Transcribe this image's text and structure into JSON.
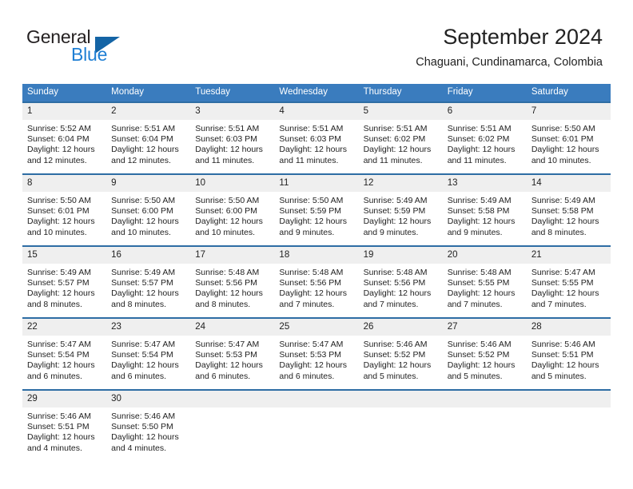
{
  "brand": {
    "name_top": "General",
    "name_bottom": "Blue",
    "triangle_icon": "triangle-logo-icon",
    "color_dark": "#231f20",
    "color_blue": "#1f7fd4",
    "color_triangle": "#1464a5"
  },
  "header": {
    "title": "September 2024",
    "subtitle": "Chaguani, Cundinamarca, Colombia"
  },
  "colors": {
    "header_row_bg": "#3a7cbe",
    "header_row_text": "#ffffff",
    "row_border": "#2e6da4",
    "daynum_bg": "#efefef",
    "text": "#222222"
  },
  "weekdays": [
    "Sunday",
    "Monday",
    "Tuesday",
    "Wednesday",
    "Thursday",
    "Friday",
    "Saturday"
  ],
  "weeks": [
    [
      {
        "day": "1",
        "sunrise": "Sunrise: 5:52 AM",
        "sunset": "Sunset: 6:04 PM",
        "daylight1": "Daylight: 12 hours",
        "daylight2": "and 12 minutes."
      },
      {
        "day": "2",
        "sunrise": "Sunrise: 5:51 AM",
        "sunset": "Sunset: 6:04 PM",
        "daylight1": "Daylight: 12 hours",
        "daylight2": "and 12 minutes."
      },
      {
        "day": "3",
        "sunrise": "Sunrise: 5:51 AM",
        "sunset": "Sunset: 6:03 PM",
        "daylight1": "Daylight: 12 hours",
        "daylight2": "and 11 minutes."
      },
      {
        "day": "4",
        "sunrise": "Sunrise: 5:51 AM",
        "sunset": "Sunset: 6:03 PM",
        "daylight1": "Daylight: 12 hours",
        "daylight2": "and 11 minutes."
      },
      {
        "day": "5",
        "sunrise": "Sunrise: 5:51 AM",
        "sunset": "Sunset: 6:02 PM",
        "daylight1": "Daylight: 12 hours",
        "daylight2": "and 11 minutes."
      },
      {
        "day": "6",
        "sunrise": "Sunrise: 5:51 AM",
        "sunset": "Sunset: 6:02 PM",
        "daylight1": "Daylight: 12 hours",
        "daylight2": "and 11 minutes."
      },
      {
        "day": "7",
        "sunrise": "Sunrise: 5:50 AM",
        "sunset": "Sunset: 6:01 PM",
        "daylight1": "Daylight: 12 hours",
        "daylight2": "and 10 minutes."
      }
    ],
    [
      {
        "day": "8",
        "sunrise": "Sunrise: 5:50 AM",
        "sunset": "Sunset: 6:01 PM",
        "daylight1": "Daylight: 12 hours",
        "daylight2": "and 10 minutes."
      },
      {
        "day": "9",
        "sunrise": "Sunrise: 5:50 AM",
        "sunset": "Sunset: 6:00 PM",
        "daylight1": "Daylight: 12 hours",
        "daylight2": "and 10 minutes."
      },
      {
        "day": "10",
        "sunrise": "Sunrise: 5:50 AM",
        "sunset": "Sunset: 6:00 PM",
        "daylight1": "Daylight: 12 hours",
        "daylight2": "and 10 minutes."
      },
      {
        "day": "11",
        "sunrise": "Sunrise: 5:50 AM",
        "sunset": "Sunset: 5:59 PM",
        "daylight1": "Daylight: 12 hours",
        "daylight2": "and 9 minutes."
      },
      {
        "day": "12",
        "sunrise": "Sunrise: 5:49 AM",
        "sunset": "Sunset: 5:59 PM",
        "daylight1": "Daylight: 12 hours",
        "daylight2": "and 9 minutes."
      },
      {
        "day": "13",
        "sunrise": "Sunrise: 5:49 AM",
        "sunset": "Sunset: 5:58 PM",
        "daylight1": "Daylight: 12 hours",
        "daylight2": "and 9 minutes."
      },
      {
        "day": "14",
        "sunrise": "Sunrise: 5:49 AM",
        "sunset": "Sunset: 5:58 PM",
        "daylight1": "Daylight: 12 hours",
        "daylight2": "and 8 minutes."
      }
    ],
    [
      {
        "day": "15",
        "sunrise": "Sunrise: 5:49 AM",
        "sunset": "Sunset: 5:57 PM",
        "daylight1": "Daylight: 12 hours",
        "daylight2": "and 8 minutes."
      },
      {
        "day": "16",
        "sunrise": "Sunrise: 5:49 AM",
        "sunset": "Sunset: 5:57 PM",
        "daylight1": "Daylight: 12 hours",
        "daylight2": "and 8 minutes."
      },
      {
        "day": "17",
        "sunrise": "Sunrise: 5:48 AM",
        "sunset": "Sunset: 5:56 PM",
        "daylight1": "Daylight: 12 hours",
        "daylight2": "and 8 minutes."
      },
      {
        "day": "18",
        "sunrise": "Sunrise: 5:48 AM",
        "sunset": "Sunset: 5:56 PM",
        "daylight1": "Daylight: 12 hours",
        "daylight2": "and 7 minutes."
      },
      {
        "day": "19",
        "sunrise": "Sunrise: 5:48 AM",
        "sunset": "Sunset: 5:56 PM",
        "daylight1": "Daylight: 12 hours",
        "daylight2": "and 7 minutes."
      },
      {
        "day": "20",
        "sunrise": "Sunrise: 5:48 AM",
        "sunset": "Sunset: 5:55 PM",
        "daylight1": "Daylight: 12 hours",
        "daylight2": "and 7 minutes."
      },
      {
        "day": "21",
        "sunrise": "Sunrise: 5:47 AM",
        "sunset": "Sunset: 5:55 PM",
        "daylight1": "Daylight: 12 hours",
        "daylight2": "and 7 minutes."
      }
    ],
    [
      {
        "day": "22",
        "sunrise": "Sunrise: 5:47 AM",
        "sunset": "Sunset: 5:54 PM",
        "daylight1": "Daylight: 12 hours",
        "daylight2": "and 6 minutes."
      },
      {
        "day": "23",
        "sunrise": "Sunrise: 5:47 AM",
        "sunset": "Sunset: 5:54 PM",
        "daylight1": "Daylight: 12 hours",
        "daylight2": "and 6 minutes."
      },
      {
        "day": "24",
        "sunrise": "Sunrise: 5:47 AM",
        "sunset": "Sunset: 5:53 PM",
        "daylight1": "Daylight: 12 hours",
        "daylight2": "and 6 minutes."
      },
      {
        "day": "25",
        "sunrise": "Sunrise: 5:47 AM",
        "sunset": "Sunset: 5:53 PM",
        "daylight1": "Daylight: 12 hours",
        "daylight2": "and 6 minutes."
      },
      {
        "day": "26",
        "sunrise": "Sunrise: 5:46 AM",
        "sunset": "Sunset: 5:52 PM",
        "daylight1": "Daylight: 12 hours",
        "daylight2": "and 5 minutes."
      },
      {
        "day": "27",
        "sunrise": "Sunrise: 5:46 AM",
        "sunset": "Sunset: 5:52 PM",
        "daylight1": "Daylight: 12 hours",
        "daylight2": "and 5 minutes."
      },
      {
        "day": "28",
        "sunrise": "Sunrise: 5:46 AM",
        "sunset": "Sunset: 5:51 PM",
        "daylight1": "Daylight: 12 hours",
        "daylight2": "and 5 minutes."
      }
    ],
    [
      {
        "day": "29",
        "sunrise": "Sunrise: 5:46 AM",
        "sunset": "Sunset: 5:51 PM",
        "daylight1": "Daylight: 12 hours",
        "daylight2": "and 4 minutes."
      },
      {
        "day": "30",
        "sunrise": "Sunrise: 5:46 AM",
        "sunset": "Sunset: 5:50 PM",
        "daylight1": "Daylight: 12 hours",
        "daylight2": "and 4 minutes."
      },
      {
        "day": "",
        "sunrise": "",
        "sunset": "",
        "daylight1": "",
        "daylight2": ""
      },
      {
        "day": "",
        "sunrise": "",
        "sunset": "",
        "daylight1": "",
        "daylight2": ""
      },
      {
        "day": "",
        "sunrise": "",
        "sunset": "",
        "daylight1": "",
        "daylight2": ""
      },
      {
        "day": "",
        "sunrise": "",
        "sunset": "",
        "daylight1": "",
        "daylight2": ""
      },
      {
        "day": "",
        "sunrise": "",
        "sunset": "",
        "daylight1": "",
        "daylight2": ""
      }
    ]
  ]
}
